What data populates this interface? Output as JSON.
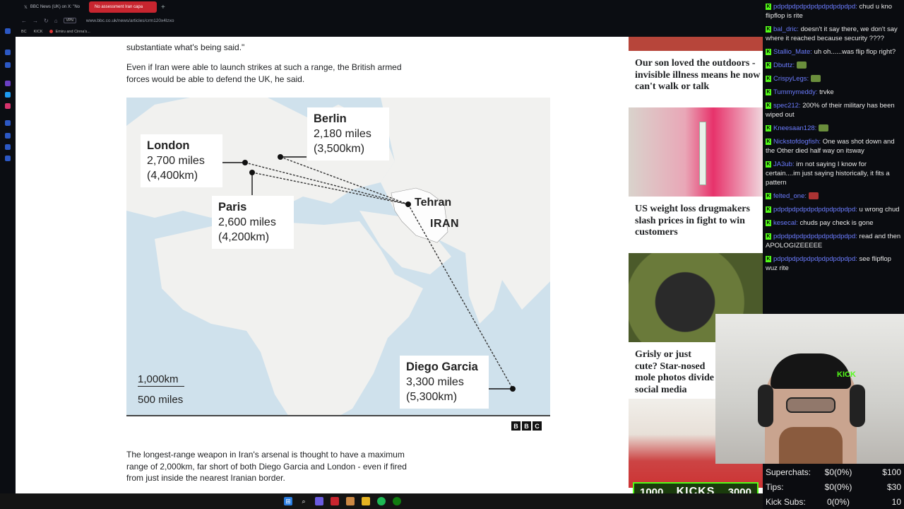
{
  "browser": {
    "tabs": [
      {
        "label": "BBC News (UK) on X: \"No"
      },
      {
        "label": "No assessment Iran capa"
      }
    ],
    "url": "www.bbc.co.uk/news/articles/crm120x4lzxo",
    "vpn": "VPN",
    "bookmarks": [
      "BC",
      "KICK",
      "Emiru and Cinna's..."
    ]
  },
  "article": {
    "top_quote": "substantiate what's being said.\"",
    "para1": "Even if Iran were able to launch strikes at such a range, the British armed forces would be able to defend the UK, he said.",
    "para2": "The longest-range weapon in Iran's arsenal is thought to have a maximum range of 2,000km, far short of both Diego Garcia and London - even if fired from just inside the nearest Iranian border."
  },
  "map": {
    "labels": [
      {
        "city": "London",
        "miles": "2,700 miles",
        "km": "(4,400km)"
      },
      {
        "city": "Berlin",
        "miles": "2,180 miles",
        "km": "(3,500km)"
      },
      {
        "city": "Paris",
        "miles": "2,600 miles",
        "km": "(4,200km)"
      },
      {
        "city": "Diego Garcia",
        "miles": "3,300 miles",
        "km": "(5,300km)"
      }
    ],
    "origin": "Tehran",
    "country": "IRAN",
    "scale_km": "1,000km",
    "scale_miles": "500 miles",
    "logo": [
      "B",
      "B",
      "C"
    ]
  },
  "sidebar": [
    {
      "title": "Our son loved the outdoors - invisible illness means he now can't walk or talk"
    },
    {
      "title": "US weight loss drugmakers slash prices in fight to win customers"
    },
    {
      "title": "Grisly or just cute? Star-nosed mole photos divide social media"
    }
  ],
  "chat": [
    {
      "user": "pdpdpdpdpdpdpdpdpdpdpd:",
      "text": "chud u kno flipflop is rite"
    },
    {
      "user": "bal_dric:",
      "text": "doesn't it say there, we don't say where it reached because security ????"
    },
    {
      "user": "Stallio_Mate:",
      "text": "uh oh......was flip flop right?"
    },
    {
      "user": "Dbuttz:",
      "text": ""
    },
    {
      "user": "CrispyLegs:",
      "text": ""
    },
    {
      "user": "Tummymeddy:",
      "text": "trvke"
    },
    {
      "user": "spec212:",
      "text": "200% of their military has been wiped out"
    },
    {
      "user": "Kneesaan128:",
      "text": ""
    },
    {
      "user": "Nickstofdogfish:",
      "text": "One was shot down and the Other died half way on itsway"
    },
    {
      "user": "JA3ub:",
      "text": "im not saying I know for certain....im just saying historically, it fits a pattern"
    },
    {
      "user": "felted_one:",
      "text": ""
    },
    {
      "user": "pdpdpdpdpdpdpdpdpdpdpd:",
      "text": "u wrong chud"
    },
    {
      "user": "kesecal:",
      "text": "chuds pay check is gone"
    },
    {
      "user": "pdpdpdpdpdpdpdpdpdpdpd:",
      "text": "read and then APOLOGIZEEEEE"
    },
    {
      "user": "pdpdpdpdpdpdpdpdpdpdpd:",
      "text": "see flipflop wuz rite"
    }
  ],
  "stats": [
    {
      "label": "Superchats:",
      "value": "$0(0%)",
      "goal": "$100"
    },
    {
      "label": "Tips:",
      "value": "$0(0%)",
      "goal": "$30"
    },
    {
      "label": "Kick Subs:",
      "value": "0(0%)",
      "goal": "10"
    }
  ],
  "kicks": {
    "current": "1000",
    "label": "KICKS",
    "goal": "3000"
  },
  "webcam": {
    "cap_text": "KICK"
  },
  "colors": {
    "kick_green": "#53fc18",
    "bbc_red": "#c8252f",
    "chat_user": "#6b7cff"
  }
}
